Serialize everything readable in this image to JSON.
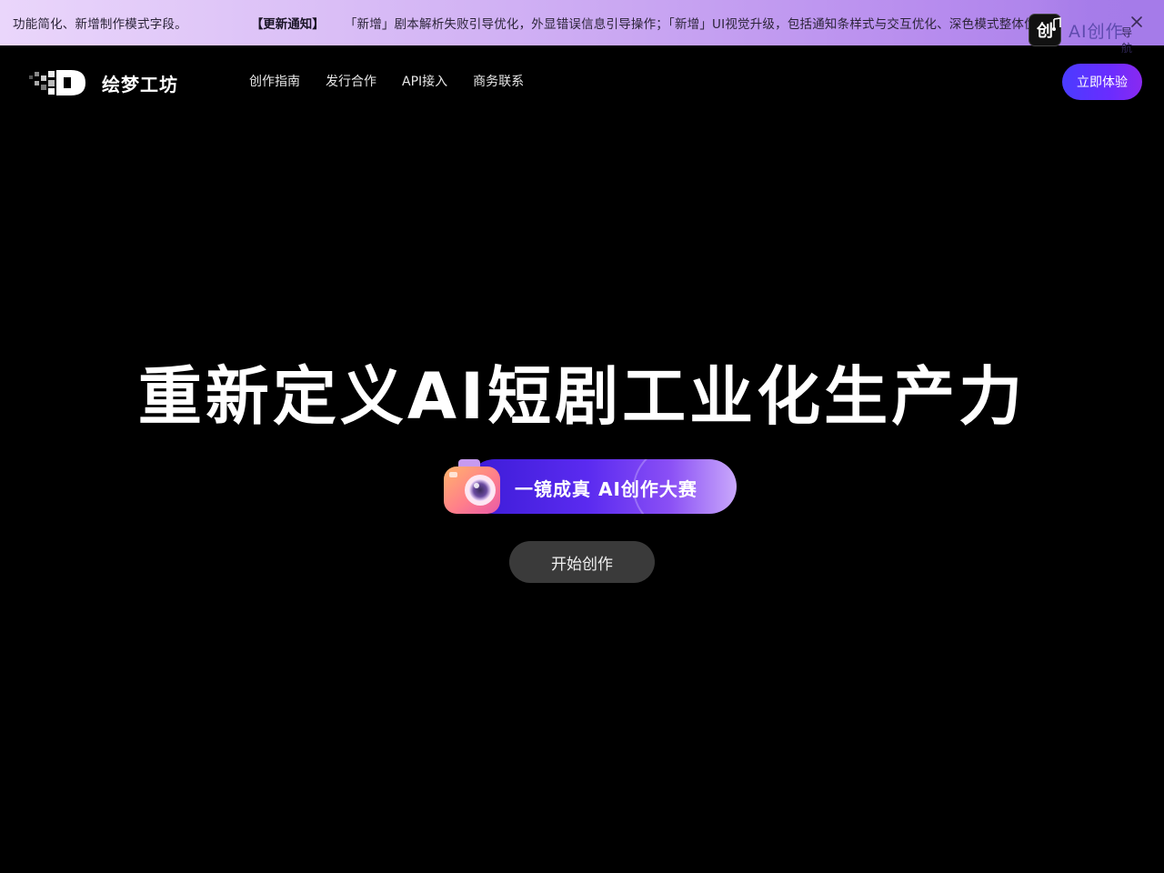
{
  "notice": {
    "prev_text": "功能简化、新增制作模式字段。",
    "tag": "【更新通知】",
    "text": "「新增」剧本解析失败引导优化，外显错误信息引导操作；「新增」UI视觉升级，包括通知条样式与交互优化、深色模式整体优化",
    "close_icon": "close-icon"
  },
  "ai_nav": {
    "icon_glyph": "创",
    "label": "AI创作",
    "sub": "导航"
  },
  "header": {
    "logo_text": "绘梦工坊",
    "nav": [
      {
        "label": "创作指南"
      },
      {
        "label": "发行合作"
      },
      {
        "label": "API接入"
      },
      {
        "label": "商务联系"
      }
    ],
    "try_label": "立即体验"
  },
  "hero": {
    "title": "重新定义AI短剧工业化生产力",
    "contest_label": "一镜成真 AI创作大赛",
    "start_label": "开始创作"
  },
  "colors": {
    "accent": "#5b2bf0",
    "notice_bg": "#c9a6f2",
    "start_btn": "#3a3a3a"
  }
}
